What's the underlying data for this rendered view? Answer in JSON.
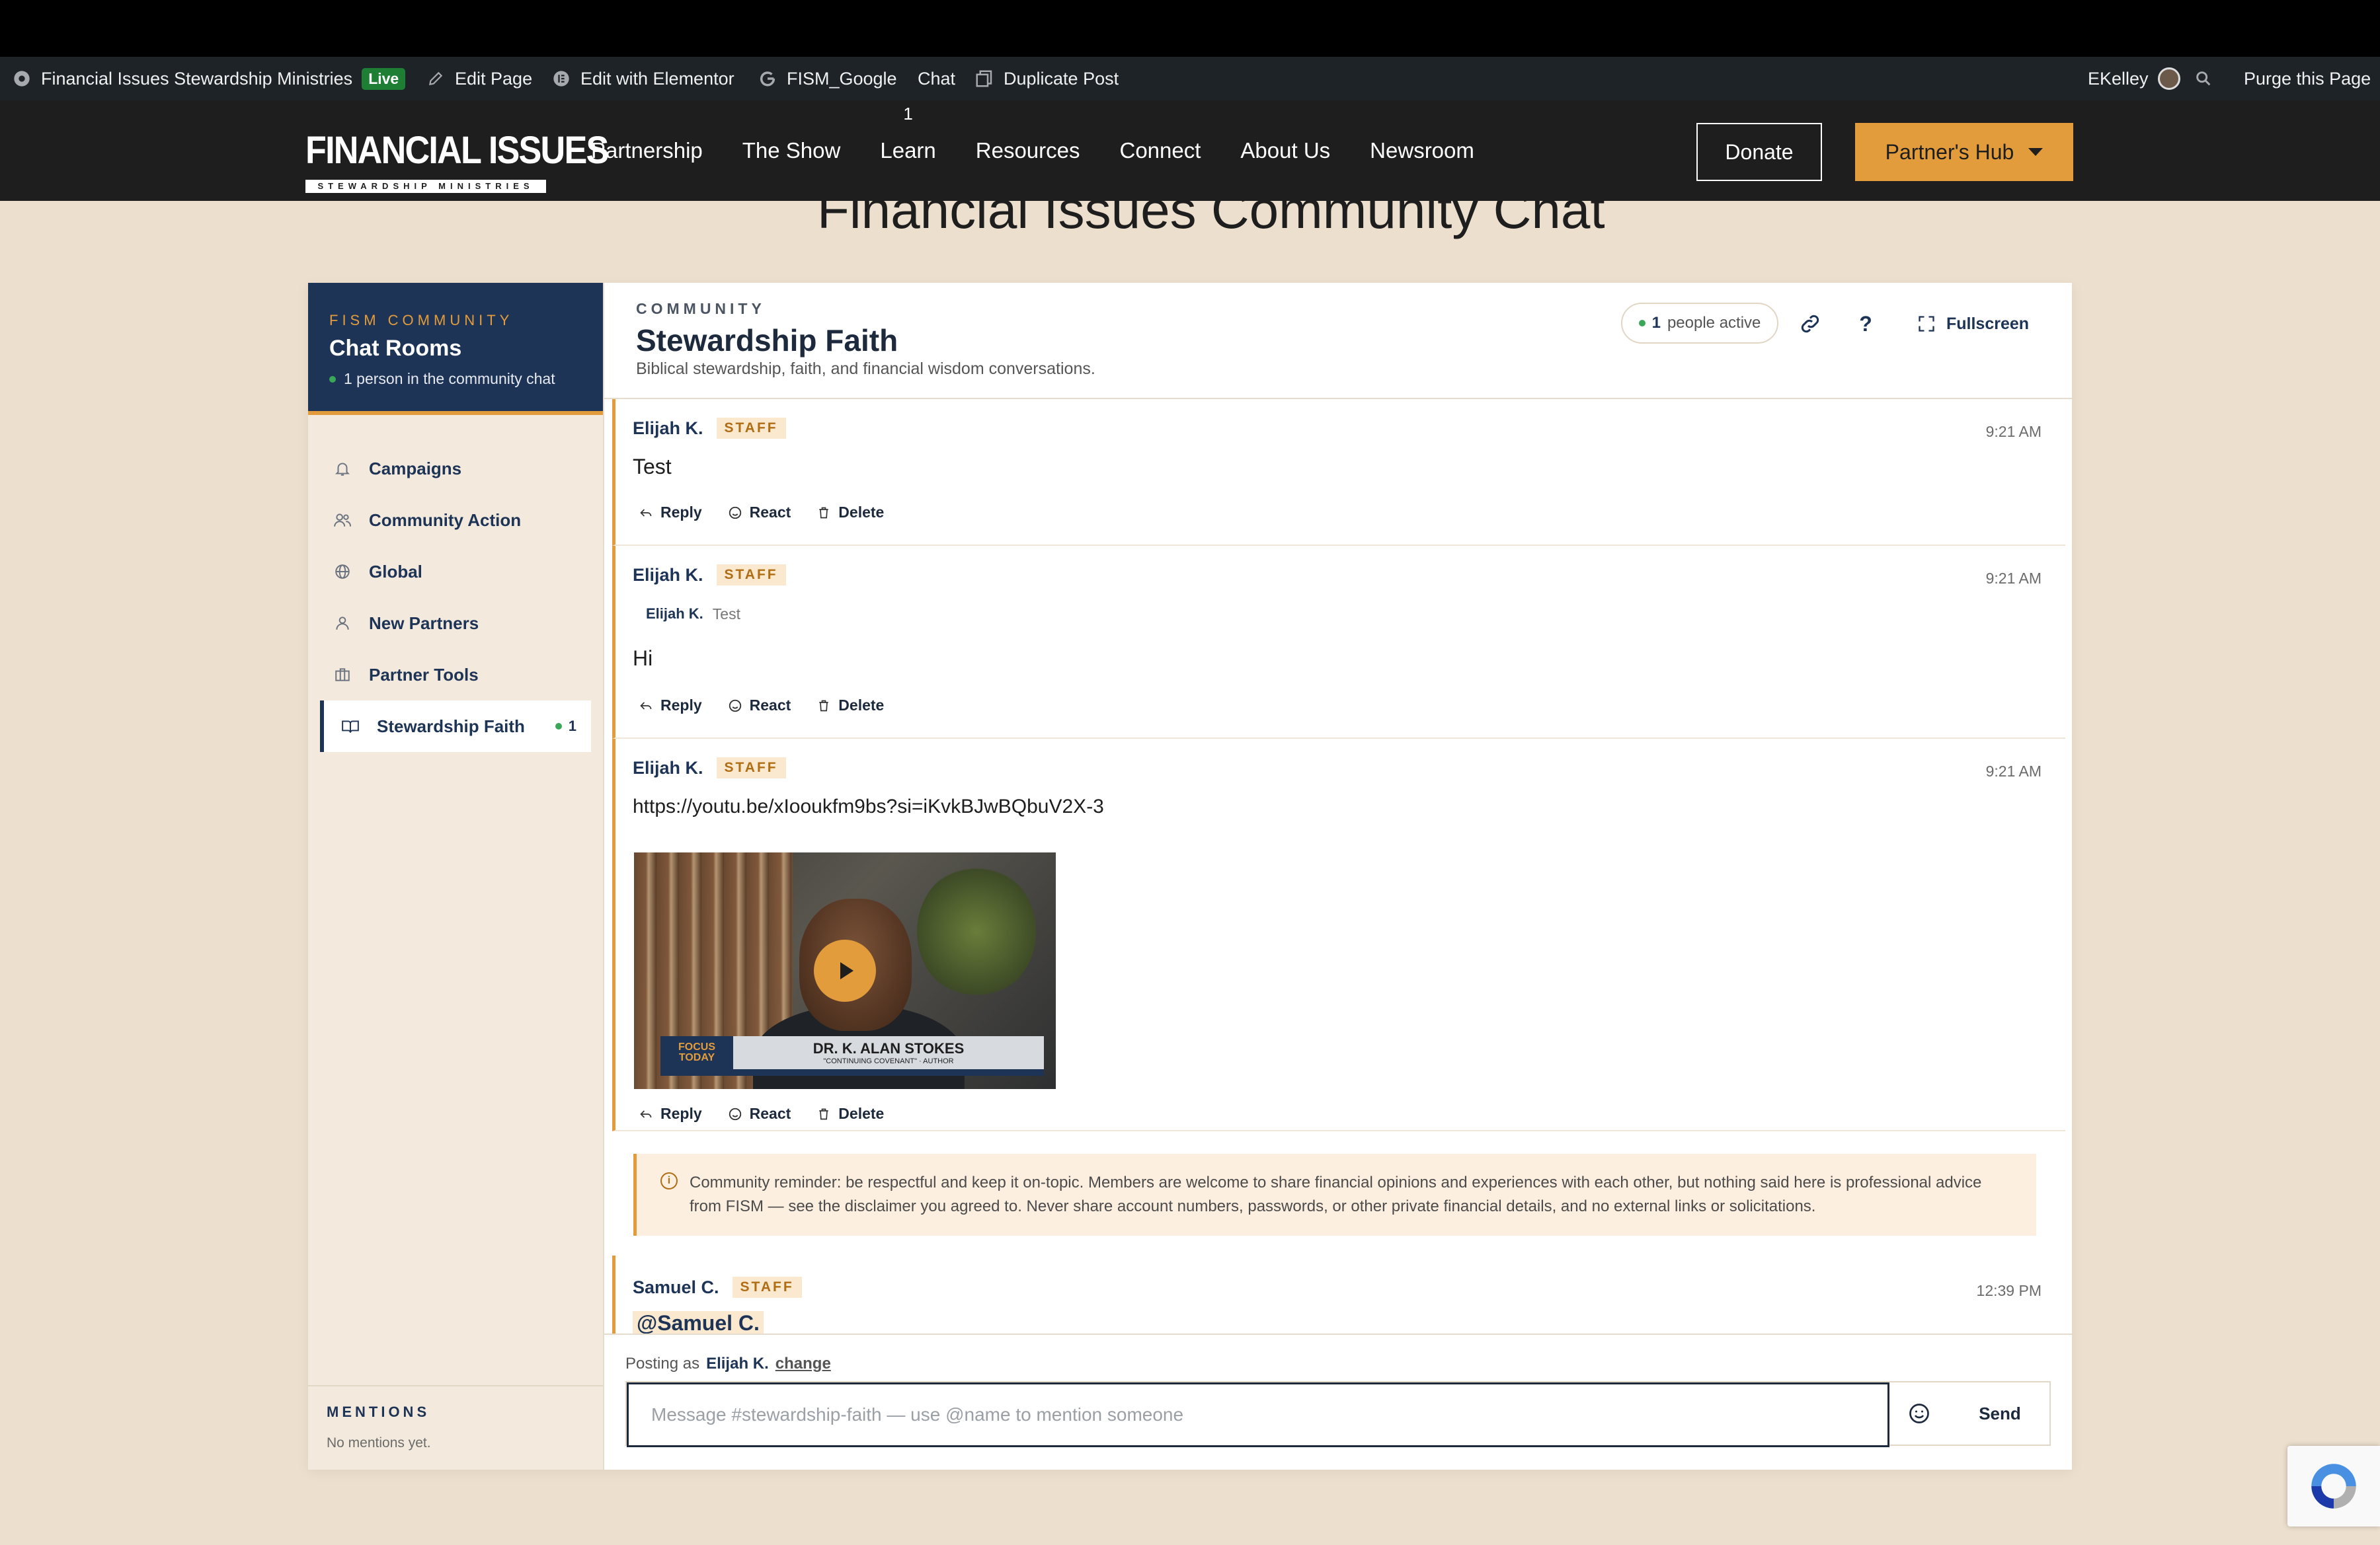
{
  "admin_bar": {
    "site_name": "Financial Issues Stewardship Ministries",
    "live_badge": "Live",
    "edit_page": "Edit Page",
    "edit_elementor": "Edit with Elementor",
    "google": "FISM_Google",
    "chat": "Chat",
    "duplicate": "Duplicate Post",
    "user": "EKelley",
    "purge": "Purge this Page"
  },
  "site_nav": {
    "logo_main": "FINANCIAL ISSUES",
    "logo_sub": "STEWARDSHIP MINISTRIES",
    "links": [
      "Partnership",
      "The Show",
      "Learn",
      "Resources",
      "Connect",
      "About Us",
      "Newsroom"
    ],
    "learn_badge": "1",
    "donate": "Donate",
    "partner_hub": "Partner's Hub"
  },
  "page_heading": "Financial Issues Community Chat",
  "sidebar": {
    "kicker": "FISM COMMUNITY",
    "title": "Chat Rooms",
    "status": "1 person in the community chat",
    "rooms": [
      {
        "label": "Campaigns",
        "icon": "bell-icon"
      },
      {
        "label": "Community Action",
        "icon": "users-icon"
      },
      {
        "label": "Global",
        "icon": "globe-icon"
      },
      {
        "label": "New Partners",
        "icon": "user-icon"
      },
      {
        "label": "Partner Tools",
        "icon": "briefcase-icon"
      },
      {
        "label": "Stewardship Faith",
        "icon": "book-icon",
        "active": true,
        "count": "1"
      }
    ],
    "mentions_title": "MENTIONS",
    "mentions_empty": "No mentions yet."
  },
  "room": {
    "kicker": "COMMUNITY",
    "title": "Stewardship Faith",
    "description": "Biblical stewardship, faith, and financial wisdom conversations.",
    "active_count": "1",
    "active_label": "people active",
    "help": "?",
    "fullscreen": "Fullscreen"
  },
  "messages": [
    {
      "author": "Elijah K.",
      "badge": "STAFF",
      "time": "9:21 AM",
      "text": "Test"
    },
    {
      "author": "Elijah K.",
      "badge": "STAFF",
      "time": "9:21 AM",
      "quote_author": "Elijah K.",
      "quote_text": "Test",
      "text": "Hi"
    },
    {
      "author": "Elijah K.",
      "badge": "STAFF",
      "time": "9:21 AM",
      "text": "https://youtu.be/xIooukfm9bs?si=iKvkBJwBQbuV2X-3",
      "video": {
        "lower_logo": "FOCUS TODAY",
        "lower_name": "DR. K. ALAN STOKES",
        "lower_role": "\"CONTINUING COVENANT\" · AUTHOR"
      }
    },
    {
      "author": "Samuel C.",
      "badge": "STAFF",
      "time": "12:39 PM",
      "text": "@Samuel C."
    }
  ],
  "actions": {
    "reply": "Reply",
    "react": "React",
    "delete": "Delete"
  },
  "notice": "Community reminder: be respectful and keep it on-topic. Members are welcome to share financial opinions and experiences with each other, but nothing said here is professional advice from FISM — see the disclaimer you agreed to. Never share account numbers, passwords, or other private financial details, and no external links or solicitations.",
  "composer": {
    "posting_as": "Posting as",
    "user": "Elijah K.",
    "change": "change",
    "placeholder": "Message #stewardship-faith — use @name to mention someone",
    "send": "Send"
  },
  "colors": {
    "navy": "#1d3456",
    "orange": "#e39c3b",
    "beige": "#ecdfcd"
  }
}
